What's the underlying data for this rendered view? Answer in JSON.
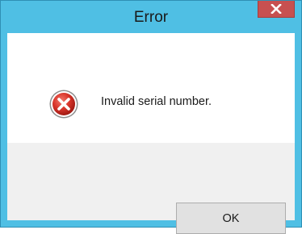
{
  "window": {
    "title": "Error",
    "close_glyph": "x",
    "frame_color": "#4fbfe4",
    "close_color": "#c75050"
  },
  "dialog": {
    "icon": "error-icon",
    "message": "Invalid serial number.",
    "ok_label": "OK"
  }
}
